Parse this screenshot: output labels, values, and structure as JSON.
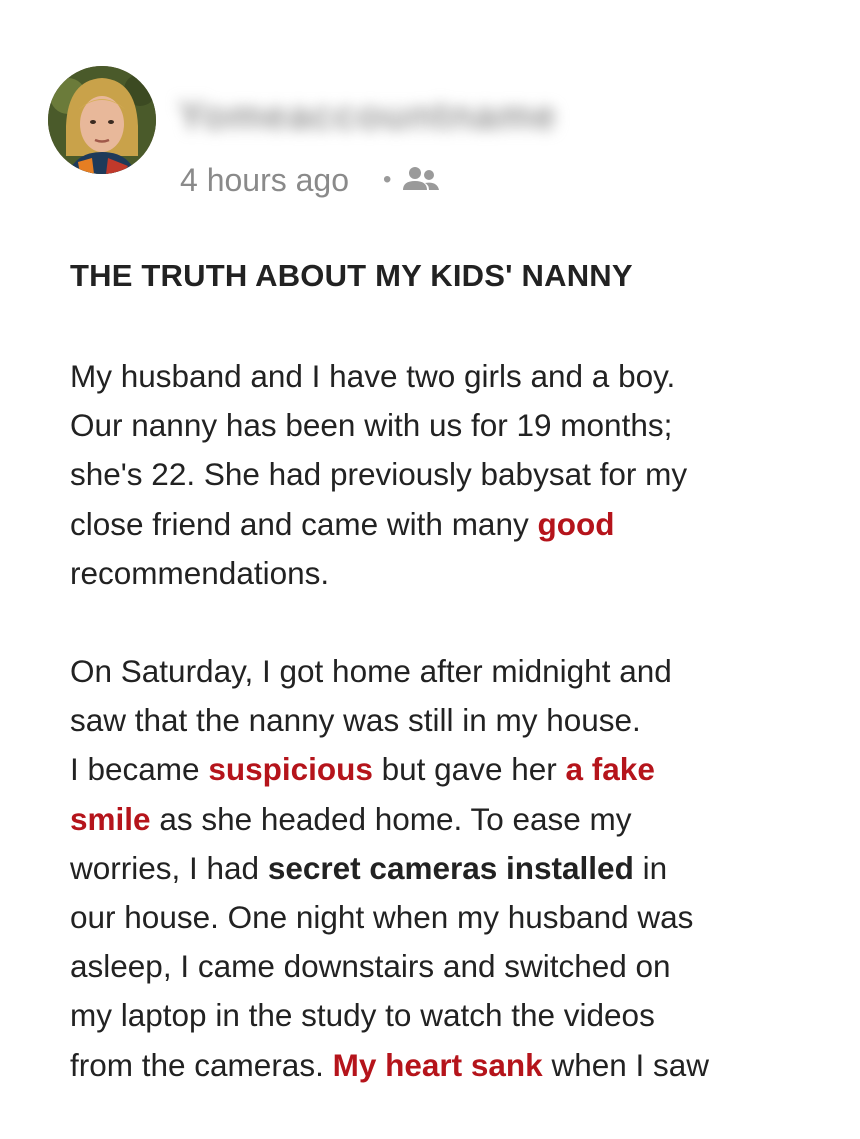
{
  "post": {
    "author_name": "Yomeaccountname",
    "timestamp": "4 hours ago",
    "separator": "•",
    "audience_icon": "group-icon",
    "title": "THE TRUTH ABOUT MY KIDS' NANNY"
  },
  "colors": {
    "highlight": "#b5141b",
    "text": "#222222",
    "meta": "#8a8a8a"
  },
  "paragraphs": [
    {
      "lines": [
        [
          {
            "t": "My husband and I have two girls and a boy.",
            "s": "n"
          }
        ],
        [
          {
            "t": "Our nanny has been with us for 19 months;",
            "s": "n"
          }
        ],
        [
          {
            "t": "she's 22. She had previously babysat for my",
            "s": "n"
          }
        ],
        [
          {
            "t": "close friend and came with many ",
            "s": "n"
          },
          {
            "t": "good",
            "s": "r"
          }
        ],
        [
          {
            "t": "recommendations.",
            "s": "n"
          }
        ]
      ]
    },
    {
      "lines": [
        [
          {
            "t": "On Saturday, I got home after midnight and",
            "s": "n"
          }
        ],
        [
          {
            "t": "saw that the nanny was still in my house.",
            "s": "n"
          }
        ],
        [
          {
            "t": "I became ",
            "s": "n"
          },
          {
            "t": "suspicious",
            "s": "r"
          },
          {
            "t": " but gave her ",
            "s": "n"
          },
          {
            "t": "a fake",
            "s": "r"
          }
        ],
        [
          {
            "t": "smile",
            "s": "r"
          },
          {
            "t": " as she headed home. To ease my",
            "s": "n"
          }
        ],
        [
          {
            "t": "worries, I had ",
            "s": "n"
          },
          {
            "t": "secret cameras installed",
            "s": "b"
          },
          {
            "t": " in",
            "s": "n"
          }
        ],
        [
          {
            "t": "our house. One night when my husband was",
            "s": "n"
          }
        ],
        [
          {
            "t": "asleep, I came downstairs and switched on",
            "s": "n"
          }
        ],
        [
          {
            "t": "my laptop in the study to watch the videos",
            "s": "n"
          }
        ],
        [
          {
            "t": "from the cameras. ",
            "s": "n"
          },
          {
            "t": "My heart sank",
            "s": "r"
          },
          {
            "t": " when I saw",
            "s": "n"
          }
        ]
      ]
    }
  ]
}
